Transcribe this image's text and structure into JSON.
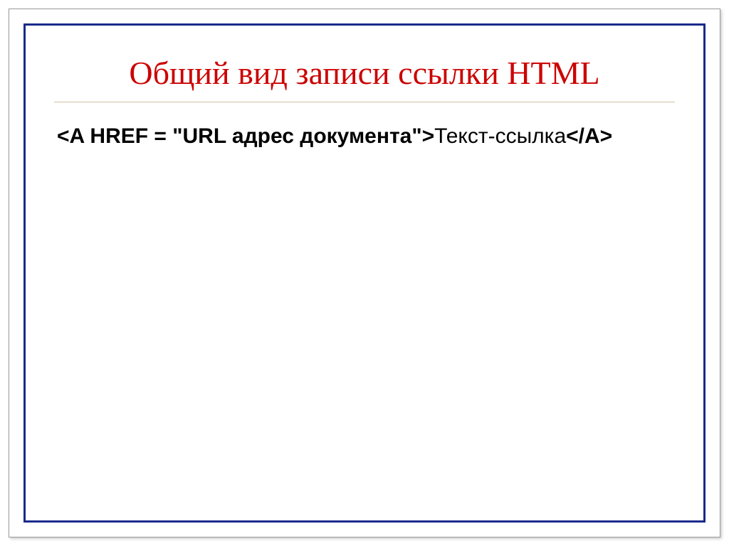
{
  "slide": {
    "title": "Общий вид записи ссылки HTML",
    "code_bold": "<A HREF = \"URL адрес документа\">",
    "code_normal": "Текст-ссылка",
    "code_close": "</A>"
  }
}
